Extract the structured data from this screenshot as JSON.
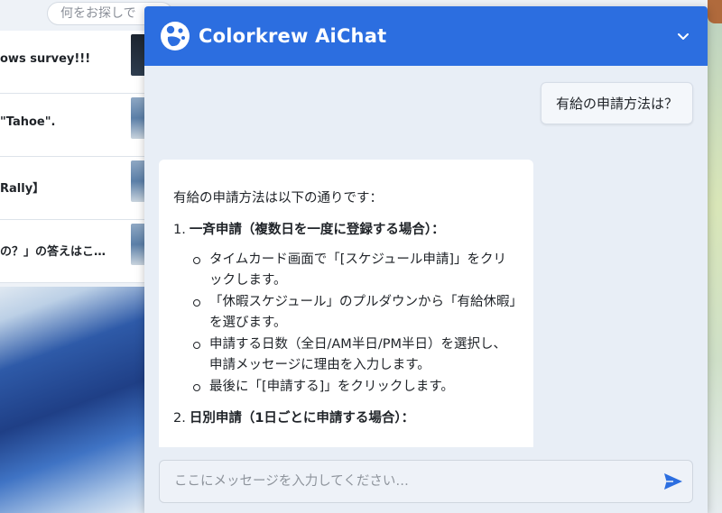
{
  "background": {
    "search_placeholder": "何をお探しで",
    "items": [
      {
        "text": "ows survey!!!"
      },
      {
        "text": "\"Tahoe\"."
      },
      {
        "text": "Rally】"
      },
      {
        "text": "の？」の答えはこ…"
      }
    ]
  },
  "chat": {
    "title": "Colorkrew AiChat",
    "accent_color": "#2c6ee0",
    "logo_icon": "colorkrew-logo-icon",
    "collapse_icon": "chevron-down-icon",
    "user_message": "有給の申請方法は？",
    "bot_message": {
      "intro": "有給の申請方法は以下の通りです：",
      "steps": [
        {
          "num": "1.",
          "title": "一斉申請（複数日を一度に登録する場合）：",
          "bullets": [
            "タイムカード画面で「[スケジュール申請]」をクリックします。",
            "「休暇スケジュール」のプルダウンから「有給休暇」を選びます。",
            "申請する日数（全日/AM半日/PM半日）を選択し、申請メッセージに理由を入力します。",
            "最後に「[申請する]」をクリックします。"
          ]
        },
        {
          "num": "2.",
          "title": "日別申請（1日ごとに申請する場合）：",
          "bullets": []
        }
      ]
    },
    "input_placeholder": "ここにメッセージを入力してください…",
    "send_icon": "send-icon"
  }
}
